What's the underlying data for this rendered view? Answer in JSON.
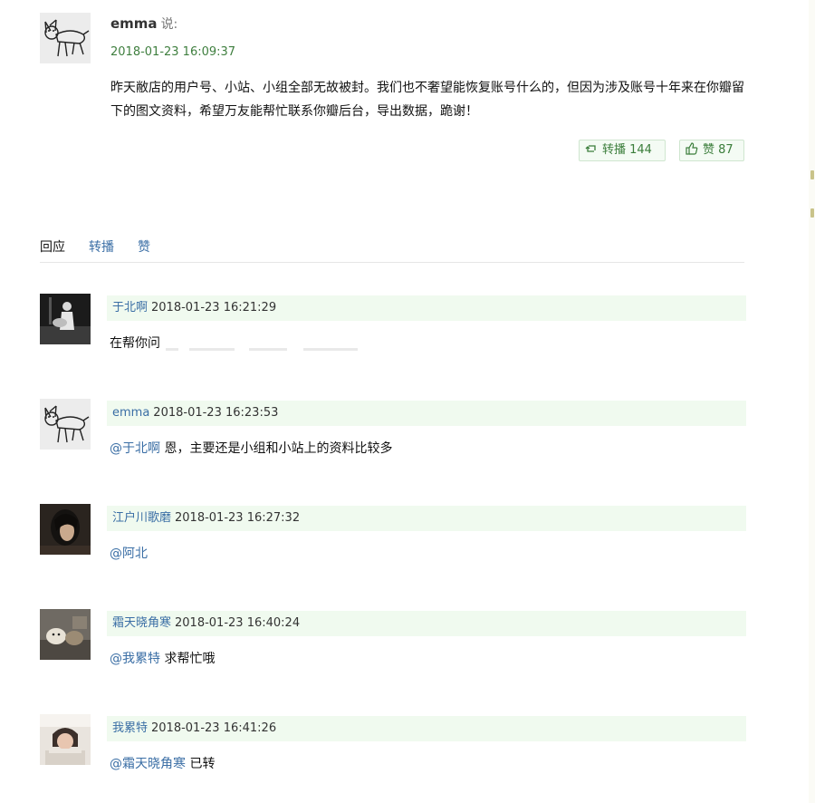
{
  "status": {
    "author": "emma",
    "say_label": "说:",
    "time": "2018-01-23 16:09:37",
    "text": "昨天敝店的用户号、小站、小组全部无故被封。我们也不奢望能恢复账号什么的，但因为涉及账号十年来在你瓣留下的图文资料，希望万友能帮忙联系你瓣后台，导出数据，跪谢！",
    "reshare_label": "转播 144",
    "like_label": "赞 87"
  },
  "tabs": {
    "reply": "回应",
    "reshare": "转播",
    "like": "赞"
  },
  "comments": [
    {
      "name": "于北啊",
      "time": "2018-01-23 16:21:29",
      "mention": "",
      "text": "在帮你问",
      "avatar": "guitar-photo"
    },
    {
      "name": "emma",
      "time": "2018-01-23 16:23:53",
      "mention": "@于北啊",
      "text": " 恩，主要还是小组和小站上的资料比较多",
      "avatar": "cat-doodle"
    },
    {
      "name": "江户川歌磨",
      "time": "2018-01-23 16:27:32",
      "mention": "@阿北",
      "text": "",
      "avatar": "woman-portrait"
    },
    {
      "name": "霜天晓角寒",
      "time": "2018-01-23 16:40:24",
      "mention": "@我累特",
      "text": " 求帮忙哦",
      "avatar": "cats-photo"
    },
    {
      "name": "我累特",
      "time": "2018-01-23 16:41:26",
      "mention": "@霜天晓角寒",
      "text": " 已转",
      "avatar": "girl-photo"
    }
  ],
  "colors": {
    "link": "#3a6ea5",
    "time_green": "#3f7f3f",
    "comment_header_bg": "#f0faef",
    "button_border": "#cfe6cf"
  },
  "icons": {
    "reshare": "reshare-icon",
    "like": "thumbs-up-icon"
  }
}
